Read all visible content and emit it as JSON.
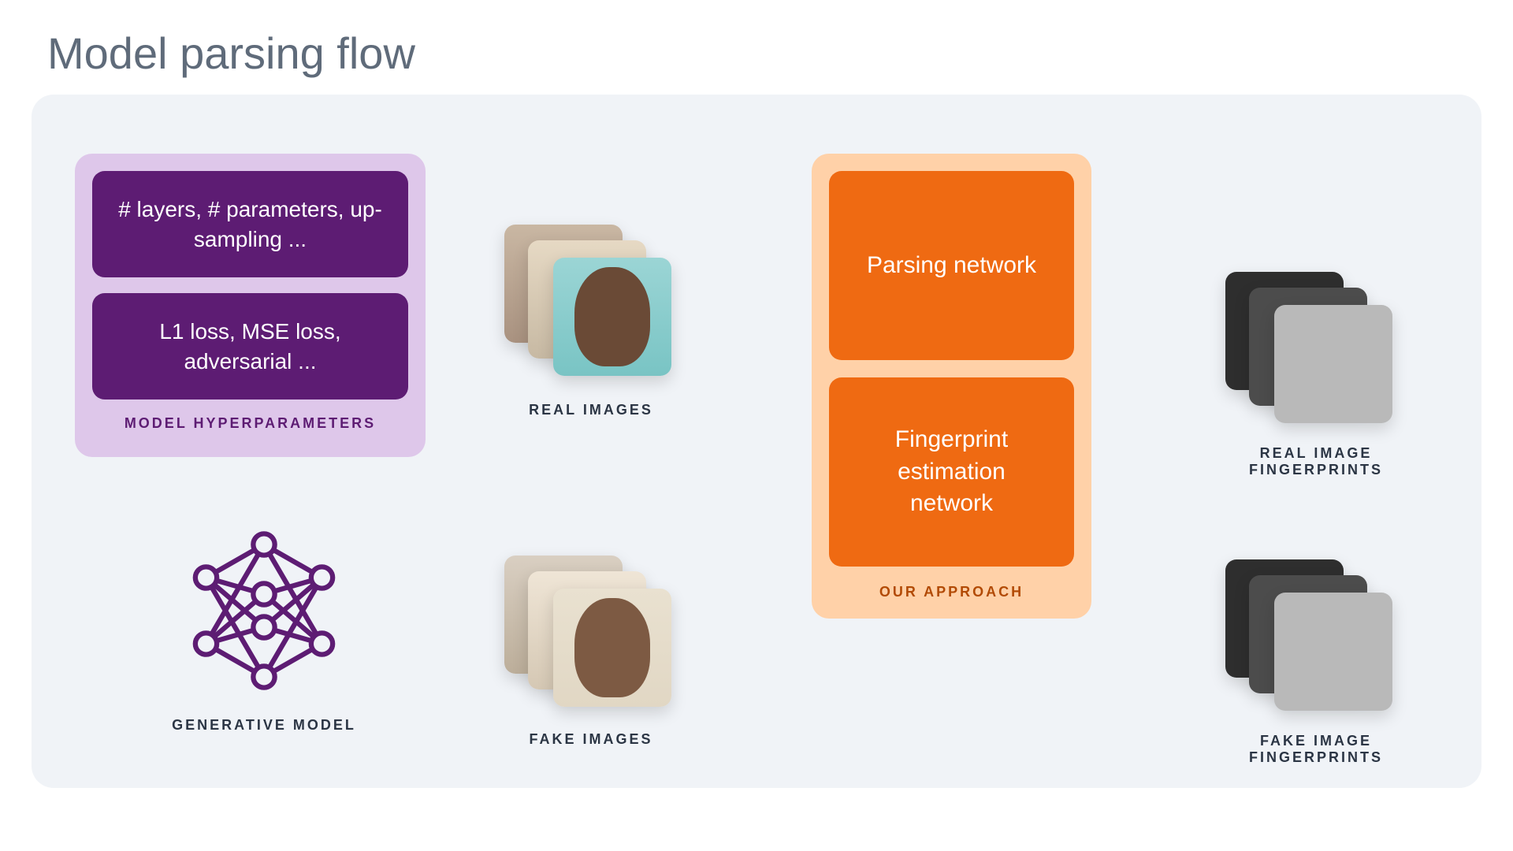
{
  "title": "Model parsing flow",
  "hyperparams": {
    "box1": "# layers, # parameters, up-sampling ...",
    "box2": "L1 loss, MSE loss, adversarial ...",
    "caption": "MODEL HYPERPARAMETERS"
  },
  "approach": {
    "block1": "Parsing network",
    "block2": "Fingerprint estimation network",
    "caption": "OUR APPROACH"
  },
  "labels": {
    "generative": "GENERATIVE MODEL",
    "real_images": "REAL IMAGES",
    "fake_images": "FAKE IMAGES",
    "real_fp": "REAL IMAGE FINGERPRINTS",
    "fake_fp": "FAKE IMAGE FINGERPRINTS"
  },
  "colors": {
    "purple": "#5d1c73",
    "lilac": "#dec7ea",
    "orange": "#ef6a12",
    "peach": "#ffd1a8",
    "line": "#6a7683",
    "bg": "#f0f3f7"
  }
}
